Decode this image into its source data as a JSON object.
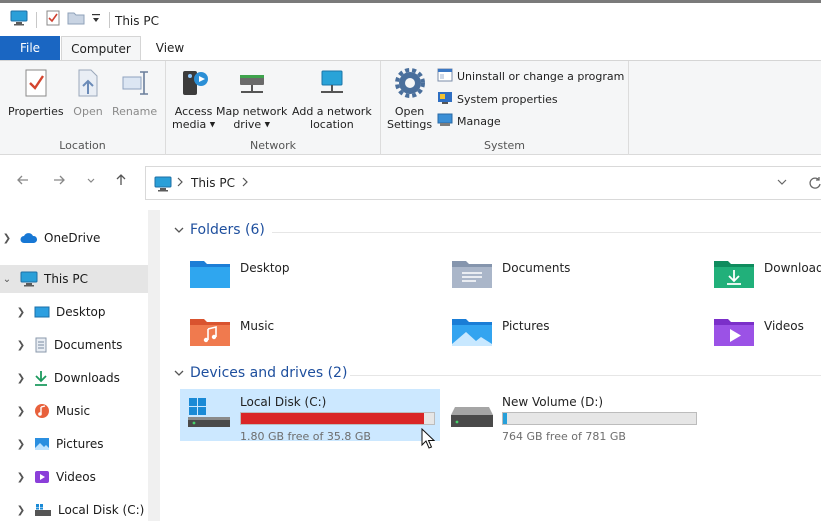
{
  "window": {
    "title": "This PC"
  },
  "tabs": {
    "file": "File",
    "computer": "Computer",
    "view": "View"
  },
  "ribbon": {
    "location": {
      "label": "Location",
      "properties": "Properties",
      "open": "Open",
      "rename": "Rename"
    },
    "network": {
      "label": "Network",
      "access_media_1": "Access",
      "access_media_2": "media",
      "map_drive_1": "Map network",
      "map_drive_2": "drive",
      "add_location_1": "Add a network",
      "add_location_2": "location"
    },
    "system": {
      "label": "System",
      "open_settings_1": "Open",
      "open_settings_2": "Settings",
      "uninstall": "Uninstall or change a program",
      "system_properties": "System properties",
      "manage": "Manage"
    }
  },
  "address": {
    "crumb_root": "This PC"
  },
  "navpane": {
    "items": [
      {
        "label": "OneDrive"
      },
      {
        "label": "This PC"
      },
      {
        "label": "Desktop"
      },
      {
        "label": "Documents"
      },
      {
        "label": "Downloads"
      },
      {
        "label": "Music"
      },
      {
        "label": "Pictures"
      },
      {
        "label": "Videos"
      },
      {
        "label": "Local Disk (C:)"
      }
    ]
  },
  "content": {
    "folders_header": "Folders (6)",
    "drives_header": "Devices and drives (2)",
    "folders": [
      {
        "name": "Desktop"
      },
      {
        "name": "Documents"
      },
      {
        "name": "Downloads"
      },
      {
        "name": "Music"
      },
      {
        "name": "Pictures"
      },
      {
        "name": "Videos"
      }
    ],
    "drives": [
      {
        "name": "Local Disk (C:)",
        "free": "1.80 GB free of 35.8 GB",
        "used_fraction": 0.95,
        "bar_color": "#da2626"
      },
      {
        "name": "New Volume (D:)",
        "free": "764 GB free of 781 GB",
        "used_fraction": 0.02,
        "bar_color": "#26a0da"
      }
    ]
  },
  "colors": {
    "accent": "#1a66c2",
    "header_blue": "#1e4f9e",
    "selection": "#cce8ff"
  }
}
